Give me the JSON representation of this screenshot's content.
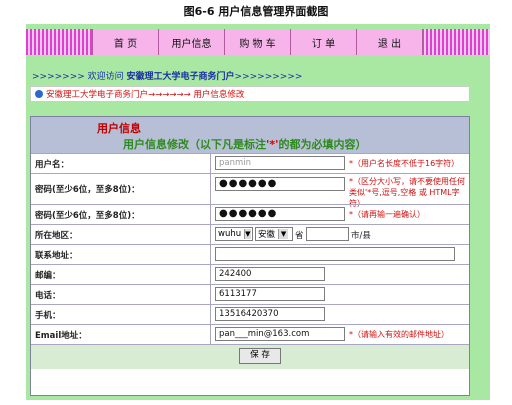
{
  "caption": "图6-6 用户信息管理界面截图",
  "nav": {
    "items": [
      "首 页",
      "用户信息",
      "购 物 车",
      "订 单",
      "退 出"
    ]
  },
  "welcome": {
    "prefix": ">>>>>>> 欢迎访问",
    "site": "安徽理工大学电子商务门户",
    "suffix": ">>>>>>>>>"
  },
  "breadcrumb": {
    "text": "安徽理工大学电子商务门户→→→→→→ 用户信息修改"
  },
  "panel": {
    "title": "用户信息",
    "subtitle": "用户信息修改（以下凡是标注",
    "subtitle_mark": "'*'",
    "subtitle_end": "的都为必填内容）"
  },
  "form": {
    "username": {
      "label": "用户名：",
      "value": "panmin",
      "hint": "*（用户名长度不低于16字符）"
    },
    "password": {
      "label": "密码(至少6位，至多8位)：",
      "value": "●●●●●●",
      "hint": "*（区分大小写，请不要使用任何类似'*号,逗号,空格 或 HTML字符）"
    },
    "confirm": {
      "label": "密码(至少6位，至多8位)：",
      "value": "●●●●●●",
      "hint": "*（请再输一遍确认）"
    },
    "region": {
      "label": "所在地区：",
      "city_select": "wuhu",
      "province_select": "安徽",
      "province_suffix": "省",
      "city_suffix": "市/县"
    },
    "address": {
      "label": "联系地址：",
      "value": ""
    },
    "postcode": {
      "label": "邮编：",
      "value": "242400"
    },
    "phone": {
      "label": "电话：",
      "value": "6113177"
    },
    "mobile": {
      "label": "手机：",
      "value": "13516420370"
    },
    "email": {
      "label": "Email地址：",
      "value": "pan___min@163.com",
      "hint": "*（请输入有效的邮件地址）"
    },
    "save_label": "保 存"
  }
}
